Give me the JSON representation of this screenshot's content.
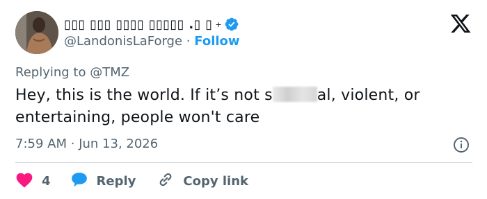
{
  "author": {
    "display_name": "▯▯▯ ▯▯▯ ▯▯▯▯ ▯▯▯▯▯ .▯ ▯",
    "sparkle": "+",
    "handle": "@LandonisLaForge",
    "separator": "·",
    "follow_label": "Follow",
    "verified": true
  },
  "reply_to": {
    "prefix": "Replying to",
    "mention": "@TMZ"
  },
  "tweet": {
    "text_before": "Hey, this is the world. If it’s not s",
    "text_after": "al, violent, or entertaining, people won't care"
  },
  "meta": {
    "time": "7:59 AM",
    "separator": "·",
    "date": "Jun 13, 2026"
  },
  "actions": {
    "like_count": "4",
    "reply_label": "Reply",
    "copy_label": "Copy link"
  },
  "colors": {
    "accent": "#1d9bf0",
    "like": "#f91880",
    "secondary_text": "#536471"
  },
  "icons": [
    "avatar",
    "verified-badge-icon",
    "x-logo-icon",
    "info-icon",
    "heart-icon",
    "reply-bubble-icon",
    "link-icon"
  ]
}
